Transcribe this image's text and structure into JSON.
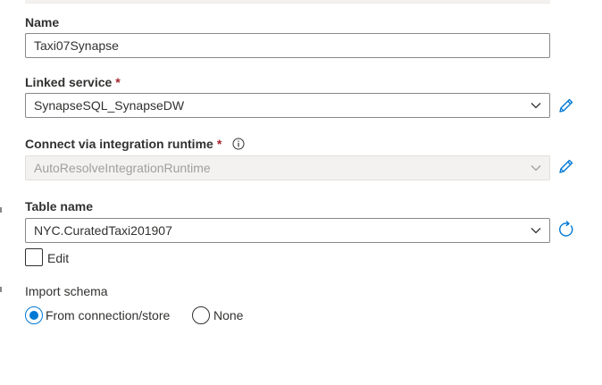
{
  "form": {
    "name": {
      "label": "Name",
      "value": "Taxi07Synapse"
    },
    "linked_service": {
      "label": "Linked service",
      "required_mark": "*",
      "value": "SynapseSQL_SynapseDW",
      "side_icon": "pencil-edit-icon"
    },
    "integration_runtime": {
      "label": "Connect via integration runtime",
      "required_mark": "*",
      "info_icon": "info-icon",
      "value": "AutoResolveIntegrationRuntime",
      "disabled": true,
      "side_icon": "pencil-edit-icon"
    },
    "table_name": {
      "label": "Table name",
      "value": "NYC.CuratedTaxi201907",
      "side_icon": "refresh-icon"
    },
    "edit_checkbox": {
      "label": "Edit",
      "checked": false
    },
    "import_schema": {
      "label": "Import schema",
      "options": [
        {
          "label": "From connection/store",
          "selected": true
        },
        {
          "label": "None",
          "selected": false
        }
      ]
    }
  },
  "colors": {
    "accent": "#0078d4",
    "required": "#a4262c",
    "border": "#8a8886",
    "disabled_text": "#a19f9d"
  }
}
